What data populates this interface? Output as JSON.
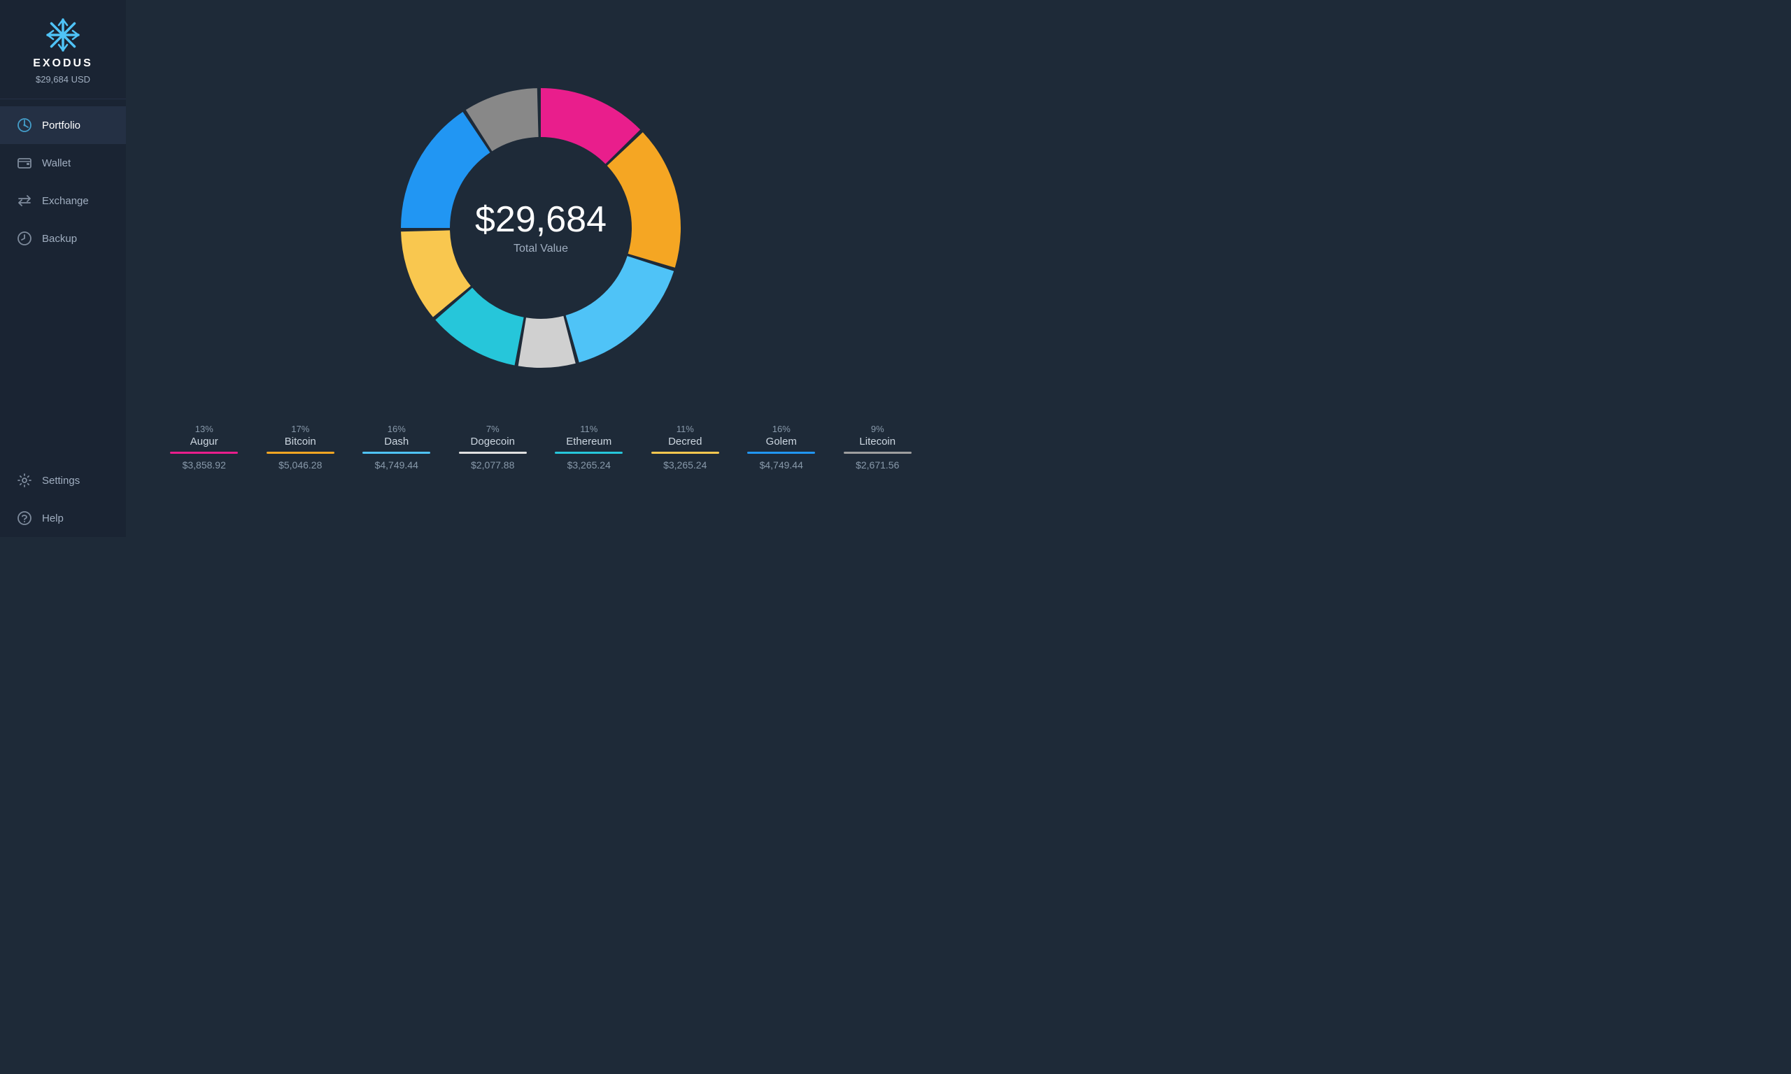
{
  "app": {
    "name": "EXODUS",
    "total_usd": "$29,684 USD"
  },
  "sidebar": {
    "nav_items": [
      {
        "id": "portfolio",
        "label": "Portfolio",
        "active": true
      },
      {
        "id": "wallet",
        "label": "Wallet",
        "active": false
      },
      {
        "id": "exchange",
        "label": "Exchange",
        "active": false
      },
      {
        "id": "backup",
        "label": "Backup",
        "active": false
      }
    ],
    "bottom_items": [
      {
        "id": "settings",
        "label": "Settings"
      },
      {
        "id": "help",
        "label": "Help"
      }
    ]
  },
  "chart": {
    "total": "$29,684",
    "label": "Total Value"
  },
  "legend": [
    {
      "id": "augur",
      "name": "Augur",
      "pct": "13%",
      "value": "$3,858.92",
      "color": "#e91e8c",
      "degrees": 46.8
    },
    {
      "id": "bitcoin",
      "name": "Bitcoin",
      "pct": "17%",
      "value": "$5,046.28",
      "color": "#f5a623",
      "degrees": 61.2
    },
    {
      "id": "dash",
      "name": "Dash",
      "pct": "16%",
      "value": "$4,749.44",
      "color": "#4fc3f7",
      "degrees": 57.6
    },
    {
      "id": "dogecoin",
      "name": "Dogecoin",
      "pct": "7%",
      "value": "$2,077.88",
      "color": "#e0e0e0",
      "degrees": 25.2
    },
    {
      "id": "ethereum",
      "name": "Ethereum",
      "pct": "11%",
      "value": "$3,265.24",
      "color": "#26c6da",
      "degrees": 39.6
    },
    {
      "id": "decred",
      "name": "Decred",
      "pct": "11%",
      "value": "$3,265.24",
      "color": "#f9c74f",
      "degrees": 39.6
    },
    {
      "id": "golem",
      "name": "Golem",
      "pct": "16%",
      "value": "$4,749.44",
      "color": "#2196f3",
      "degrees": 57.6
    },
    {
      "id": "litecoin",
      "name": "Litecoin",
      "pct": "9%",
      "value": "$2,671.56",
      "color": "#9e9e9e",
      "degrees": 32.4
    }
  ],
  "donut": {
    "segments": [
      {
        "name": "Augur",
        "pct": 13,
        "color": "#e91e8c"
      },
      {
        "name": "Bitcoin",
        "pct": 17,
        "color": "#f5a623"
      },
      {
        "name": "Dash",
        "pct": 16,
        "color": "#4fc3f7"
      },
      {
        "name": "Dogecoin",
        "pct": 7,
        "color": "#d0d0d0"
      },
      {
        "name": "Ethereum",
        "pct": 11,
        "color": "#26c6da"
      },
      {
        "name": "Decred",
        "pct": 11,
        "color": "#f9c74f"
      },
      {
        "name": "Golem",
        "pct": 16,
        "color": "#2196f3"
      },
      {
        "name": "Litecoin",
        "pct": 9,
        "color": "#888"
      }
    ]
  }
}
